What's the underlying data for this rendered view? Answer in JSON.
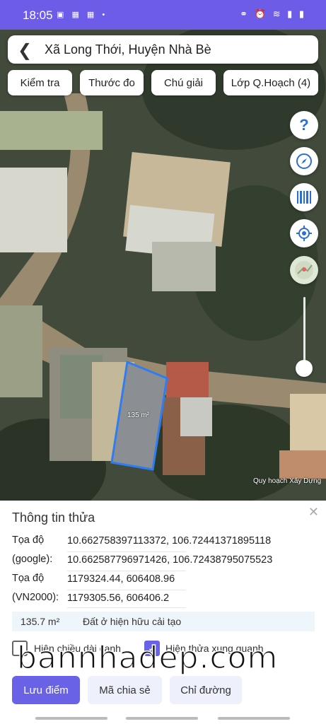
{
  "status_bar": {
    "time": "18:05",
    "left_icons": "▣ ▦ ▦ •",
    "right_icons": "⚭ ⏰ ≋ ▮ ▮"
  },
  "header": {
    "title": "Xã Long Thới, Huyện Nhà Bè",
    "back_icon": "chevron-left-icon"
  },
  "chips": [
    "Kiểm tra",
    "Thước đo",
    "Chú giải",
    "Lớp Q.Hoạch (4)"
  ],
  "map": {
    "parcel_area_label": "135 m²",
    "watermark": "Quy hoạch Xây Dựng"
  },
  "right_controls": [
    "help-icon",
    "compass-icon",
    "barcode-icon",
    "locate-icon",
    "map-layers-icon"
  ],
  "panel": {
    "title": "Thông tin thửa",
    "rows": [
      {
        "label": "Tọa độ",
        "value": "10.662758397113372, 106.72441371895118"
      },
      {
        "label": "(google):",
        "value": "10.662587796971426, 106.72438795075523"
      },
      {
        "label": "Tọa độ",
        "value": "1179324.44, 606408.96"
      },
      {
        "label": "(VN2000):",
        "value": "1179305.56, 606406.2"
      }
    ],
    "area": "135.7 m²",
    "land_type": "Đất ở hiện hữu cải tạo",
    "checkbox_1": "Hiện chiều dài cạnh",
    "checkbox_2": "Hiện thửa xung quanh",
    "buttons": {
      "primary": "Lưu điểm",
      "share": "Mã chia sẻ",
      "directions": "Chỉ đường"
    }
  },
  "overlay_watermark": "bannhadep.com"
}
